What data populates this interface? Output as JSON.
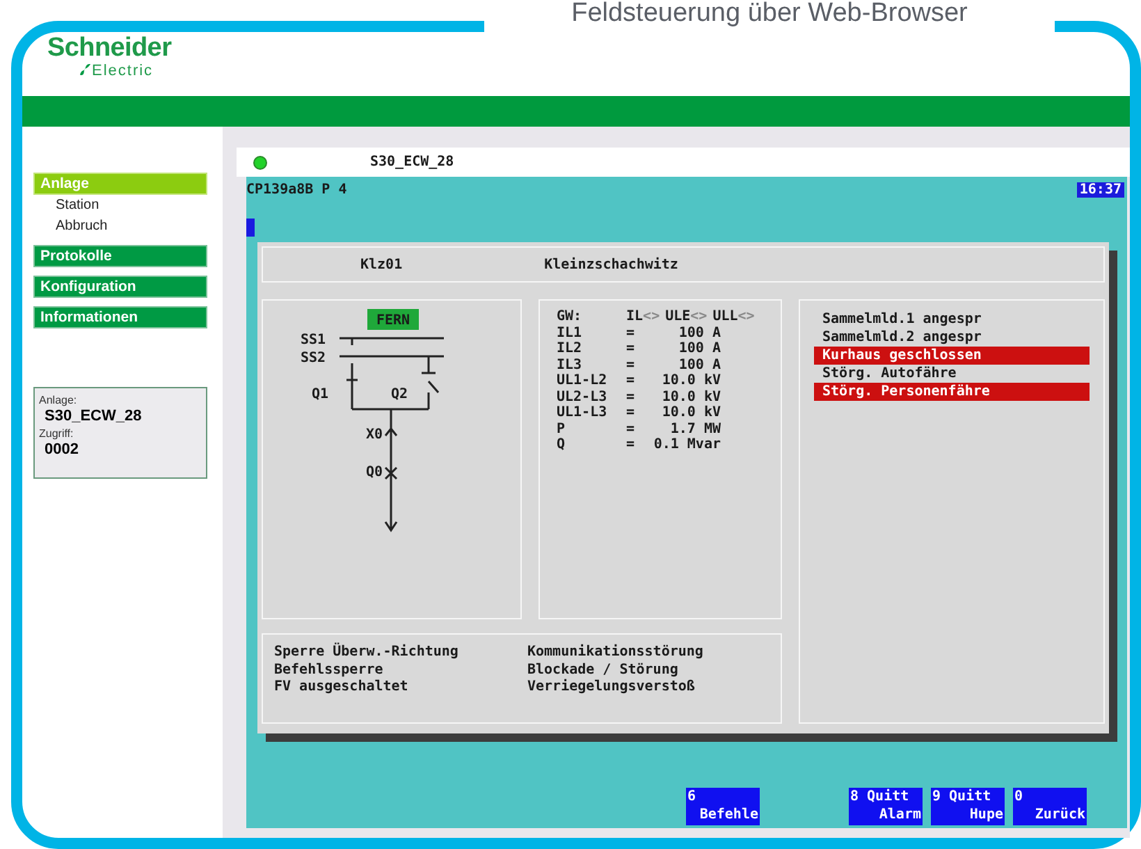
{
  "slide_title": "Feldsteuerung über Web-Browser",
  "logo": {
    "name": "Schneider",
    "sub": "Electric"
  },
  "sidebar": {
    "items": [
      {
        "label": "Anlage",
        "selected": true,
        "children": [
          {
            "label": "Station"
          },
          {
            "label": "Abbruch"
          }
        ]
      },
      {
        "label": "Protokolle",
        "selected": false
      },
      {
        "label": "Konfiguration",
        "selected": false
      },
      {
        "label": "Informationen",
        "selected": false
      }
    ],
    "info": {
      "anlage_label": "Anlage:",
      "anlage_value": "S30_ECW_28",
      "zugriff_label": "Zugriff:",
      "zugriff_value": "0002"
    }
  },
  "screen": {
    "connected": true,
    "station": "S30_ECW_28",
    "page": "CP139a8B P 4",
    "time": "16:37",
    "header": {
      "code": "Klz01",
      "name": "Kleinzschachwitz"
    },
    "diagram": {
      "mode": "FERN",
      "labels": [
        "SS1",
        "SS2",
        "Q1",
        "Q2",
        "X0",
        "Q0"
      ]
    },
    "gw": {
      "label": "GW:",
      "items": [
        {
          "label": "IL",
          "arrows": "<>"
        },
        {
          "label": "ULE",
          "arrows": "<>"
        },
        {
          "label": "ULL",
          "arrows": "<>"
        }
      ]
    },
    "measurements": [
      {
        "name": "IL1",
        "eq": "=",
        "value": "100 A"
      },
      {
        "name": "IL2",
        "eq": "=",
        "value": "100 A"
      },
      {
        "name": "IL3",
        "eq": "=",
        "value": "100 A"
      },
      {
        "name": "UL1-L2",
        "eq": "=",
        "value": "10.0 kV"
      },
      {
        "name": "UL2-L3",
        "eq": "=",
        "value": "10.0 kV"
      },
      {
        "name": "UL1-L3",
        "eq": "=",
        "value": "10.0 kV"
      },
      {
        "name": "P",
        "eq": "=",
        "value": "1.7 MW"
      },
      {
        "name": "Q",
        "eq": "=",
        "value": "0.1 Mvar"
      }
    ],
    "alarms": [
      {
        "text": "Sammelmld.1 angespr",
        "active": false
      },
      {
        "text": "Sammelmld.2 angespr",
        "active": false
      },
      {
        "text": "Kurhaus geschlossen",
        "active": true
      },
      {
        "text": "Störg. Autofähre",
        "active": false
      },
      {
        "text": "Störg. Personenfähre",
        "active": true
      }
    ],
    "status_left": [
      "Sperre Überw.-Richtung",
      "Befehlssperre",
      "FV ausgeschaltet"
    ],
    "status_right": [
      "Kommunikationsstörung",
      "Blockade / Störung",
      "Verriegelungsverstoß"
    ],
    "keys": [
      {
        "key": "6",
        "label": "Befehle",
        "kind": "gap"
      },
      {
        "key": "8 Quitt",
        "label": "Alarm",
        "kind": "plain"
      },
      {
        "key": "9 Quitt",
        "label": "Hupe",
        "kind": "plain"
      },
      {
        "key": "0",
        "label": "Zurück",
        "kind": "plain"
      }
    ]
  }
}
